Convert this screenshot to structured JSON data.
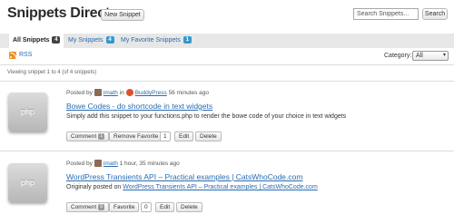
{
  "header": {
    "title": "Snippets Directory",
    "new_snippet_label": "New Snippet",
    "search_placeholder": "Search Snippets...",
    "search_button_label": "Search"
  },
  "tabs": [
    {
      "label": "All Snippets",
      "count": "4",
      "active": true
    },
    {
      "label": "My Snippets",
      "count": "4",
      "active": false
    },
    {
      "label": "My Favorite Snippets",
      "count": "1",
      "active": false
    }
  ],
  "rss_label": "RSS",
  "category": {
    "label": "Category:",
    "selected": "All"
  },
  "viewing_text": "Viewing snippet 1 to 4 (of 4 snippets)",
  "snippets": [
    {
      "thumb_label": "php",
      "posted_by": "Posted by",
      "author": "imath",
      "in_word": "in",
      "group": "BuddyPress",
      "time": "56 minutes ago",
      "title": "Bowe Codes - do shortcode in text widgets",
      "description": "Simply add this snippet to your functions.php to render the bowe code of your choice in text widgets",
      "comment_label": "Comment",
      "comment_count": "1",
      "favorite_label": "Remove Favorite",
      "favorite_count": "1",
      "edit_label": "Edit",
      "delete_label": "Delete"
    },
    {
      "thumb_label": "php",
      "posted_by": "Posted by",
      "author": "imath",
      "time": "1 hour, 35 minutes ago",
      "title": "WordPress Transients API – Practical examples | CatsWhoCode.com",
      "description_prefix": "Originaly posted on",
      "description_link": "WordPress Transients API – Practical examples | CatsWhoCode.com",
      "comment_label": "Comment",
      "comment_count": "0",
      "favorite_label": "Favorite",
      "favorite_count": "0",
      "edit_label": "Edit",
      "delete_label": "Delete"
    }
  ],
  "colors": {
    "link": "#2a6bb0",
    "tab_bar": "#e7e7e7",
    "rss": "#f28c1e",
    "count_blue": "#3399cc"
  }
}
